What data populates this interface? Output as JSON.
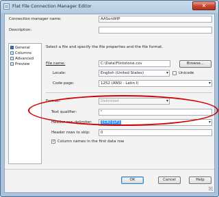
{
  "window": {
    "title": "Flat File Connection Manager Editor",
    "close_glyph": "✕"
  },
  "connection_name": {
    "label": "Connection manager name:",
    "value": "AASonWIP"
  },
  "description": {
    "label": "Description:",
    "value": ""
  },
  "nav": {
    "items": [
      {
        "label": "General",
        "selected": true
      },
      {
        "label": "Columns",
        "selected": false
      },
      {
        "label": "Advanced",
        "selected": false
      },
      {
        "label": "Preview",
        "selected": false
      }
    ]
  },
  "intro_text": "Select a file and specify the file properties and the file format.",
  "file_name": {
    "label": "File name:",
    "value": "C:\\Data\\Flintstone.csv",
    "browse": "Browse..."
  },
  "locale": {
    "label": "Locale:",
    "value": "English (United States)",
    "unicode_label": "Unicode"
  },
  "code_page": {
    "label": "Code page:",
    "value": "1252  (ANSI - Latin I)"
  },
  "format": {
    "label": "Format:",
    "value": "Delimited"
  },
  "text_qualifier": {
    "label": "Text qualifier:",
    "value": "\""
  },
  "header_delimiter": {
    "label": "Header row delimiter:",
    "value": "{CR}{LF}"
  },
  "header_rows_skip": {
    "label": "Header rows to skip:",
    "value": "0"
  },
  "column_names": {
    "label": "Column names in the first data row",
    "checked": true
  },
  "buttons": {
    "ok": "OK",
    "cancel": "Cancel",
    "help": "Help"
  },
  "colors": {
    "annotation": "#d10000",
    "selection": "#3399ff"
  }
}
